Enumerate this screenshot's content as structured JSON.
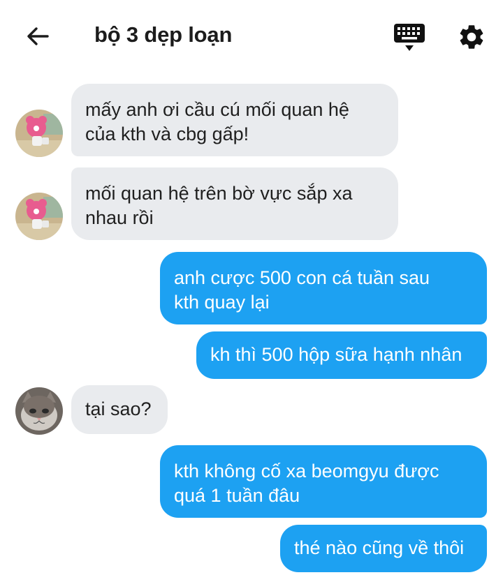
{
  "header": {
    "title": "bộ 3 dẹp loạn",
    "back_icon": "arrow-left-icon",
    "keyboard_icon": "keyboard-icon",
    "settings_icon": "gear-icon"
  },
  "colors": {
    "outgoing": "#1da1f2",
    "incoming": "#e9ebee"
  },
  "messages": [
    {
      "direction": "in",
      "avatar": "pink-character-avatar",
      "text": "mấy anh ơi cầu cú mối quan hệ\ncủa kth và cbg gấp!"
    },
    {
      "direction": "in",
      "avatar": "pink-character-avatar",
      "text": "mối quan hệ trên bờ vực sắp xa\nnhau rồi"
    },
    {
      "direction": "out",
      "text": "anh cược 500 con cá tuần sau\nkth quay lại"
    },
    {
      "direction": "out",
      "text": "kh thì 500 hộp sữa hạnh nhân"
    },
    {
      "direction": "in",
      "avatar": "cat-avatar",
      "text": "tại sao?"
    },
    {
      "direction": "out",
      "text": "kth không cố xa beomgyu được\nquá 1 tuần đâu"
    },
    {
      "direction": "out",
      "text": "thé nào cũng về thôi"
    }
  ]
}
